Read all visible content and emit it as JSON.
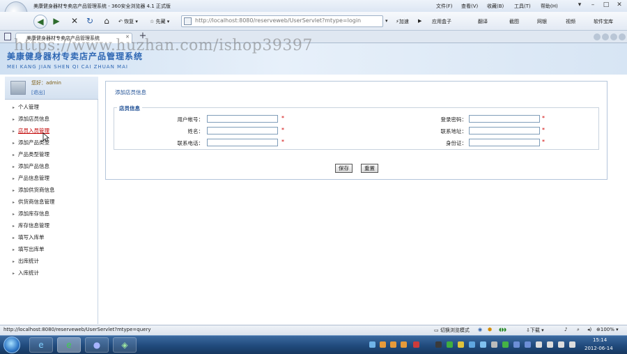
{
  "window": {
    "title": "美康健身器材专卖店产品管理系统 - 360安全浏览器 4.1 正式版",
    "menu": [
      "文件(F)",
      "查看(V)",
      "收藏(B)",
      "工具(T)",
      "帮助(H)"
    ]
  },
  "toolbar": {
    "restore_label": "恢复",
    "favorites_label": "先藏",
    "address": "http://localhost:8080/reserveweb/UserServlet?mtype=login",
    "accelerate_label": "加速",
    "right_items": [
      "应用盒子",
      "翻译",
      "截图",
      "网银",
      "视频",
      "软件宝库"
    ]
  },
  "tabs": [
    {
      "label": "美康健身器材专卖店产品管理系统"
    }
  ],
  "banner": {
    "title": "美康健身器材专卖店产品管理系统",
    "subtitle": "MEI KANG JIAN SHEN QI CAI ZHUAN MAI"
  },
  "watermark": "https://www.huzhan.com/ishop39397",
  "user": {
    "welcome": "您好：admin",
    "logout": "[退出]"
  },
  "sidebar": {
    "items": [
      {
        "label": "个人管理",
        "active": false
      },
      {
        "label": "添加店员信息",
        "active": false
      },
      {
        "label": "店员入员管理",
        "active": true
      },
      {
        "label": "添加产品类型",
        "active": false
      },
      {
        "label": "产品类型管理",
        "active": false
      },
      {
        "label": "添加产品信息",
        "active": false
      },
      {
        "label": "产品信息管理",
        "active": false
      },
      {
        "label": "添加供货商信息",
        "active": false
      },
      {
        "label": "供货商信息管理",
        "active": false
      },
      {
        "label": "添加库存信息",
        "active": false
      },
      {
        "label": "库存信息管理",
        "active": false
      },
      {
        "label": "填写入库单",
        "active": false
      },
      {
        "label": "填写出库单",
        "active": false
      },
      {
        "label": "出库统计",
        "active": false
      },
      {
        "label": "入库统计",
        "active": false
      }
    ]
  },
  "form": {
    "title": "添加店员信息",
    "legend": "店员信息",
    "required_mark": "*",
    "fields": [
      {
        "label": "用户帐号：",
        "value": ""
      },
      {
        "label": "登录密码：",
        "value": ""
      },
      {
        "label": "姓名：",
        "value": ""
      },
      {
        "label": "联系地址：",
        "value": ""
      },
      {
        "label": "联系电话：",
        "value": ""
      },
      {
        "label": "身份证：",
        "value": ""
      }
    ],
    "save_label": "保存",
    "reset_label": "重置"
  },
  "statusbar": {
    "url": "http://localhost:8080/reserveweb/UserServlet?mtype=query",
    "compat_mode": "切换浏览模式",
    "download": "下载",
    "zoom": "100%"
  },
  "taskbar": {
    "time": "15:14",
    "date": "2012-06-14"
  },
  "colors": {
    "brand_blue": "#2d66b3",
    "active_link": "#c00000",
    "required": "#d00000"
  }
}
